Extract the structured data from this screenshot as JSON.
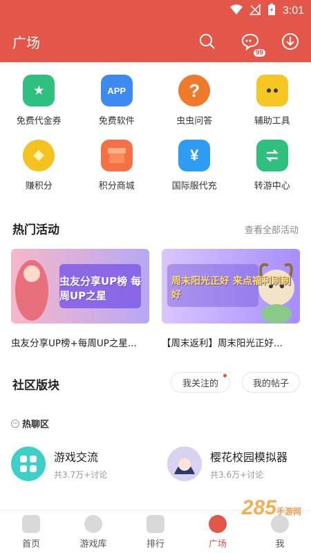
{
  "status": {
    "time": "3:01"
  },
  "header": {
    "title": "广场",
    "badge": "99"
  },
  "grid": [
    {
      "label": "免费代金券",
      "icon": "coupon-icon",
      "color": "#2fbf7f"
    },
    {
      "label": "免费软件",
      "icon": "app-icon",
      "color": "#3d8bf2",
      "text": "APP"
    },
    {
      "label": "虫虫问答",
      "icon": "question-icon",
      "color": "#f07a2c",
      "text": "?"
    },
    {
      "label": "辅助工具",
      "icon": "robot-icon",
      "color": "#f6c623"
    },
    {
      "label": "赚积分",
      "icon": "coin-icon",
      "color": "#f4c21f"
    },
    {
      "label": "积分商城",
      "icon": "shop-icon",
      "color": "#f27245"
    },
    {
      "label": "国际服代充",
      "icon": "wallet-icon",
      "color": "#2d9cf2",
      "text": "¥"
    },
    {
      "label": "转游中心",
      "icon": "transfer-icon",
      "color": "#2fbf7f"
    }
  ],
  "hot": {
    "title": "热门活动",
    "link": "查看全部活动"
  },
  "banners": [
    {
      "title": "虫友分享UP榜+每周UP之星...",
      "art": "虫友分享UP榜 每周UP之星"
    },
    {
      "title": "【周末返利】周末阳光正好...",
      "art": "周末阳光正好 来点福利刷刷好"
    }
  ],
  "community": {
    "title": "社区版块",
    "pill1": "我关注的",
    "pill2": "我的帖子",
    "hot_label": "热聊区"
  },
  "forums": [
    {
      "name": "游戏交流",
      "meta": "共3.7万+讨论"
    },
    {
      "name": "樱花校园模拟器",
      "meta": "共3.6万+讨论"
    }
  ],
  "nav": [
    {
      "label": "首页"
    },
    {
      "label": "游戏库"
    },
    {
      "label": "排行"
    },
    {
      "label": "广场"
    },
    {
      "label": "我"
    }
  ],
  "watermark": {
    "main": "285",
    "sub": "手游网"
  }
}
